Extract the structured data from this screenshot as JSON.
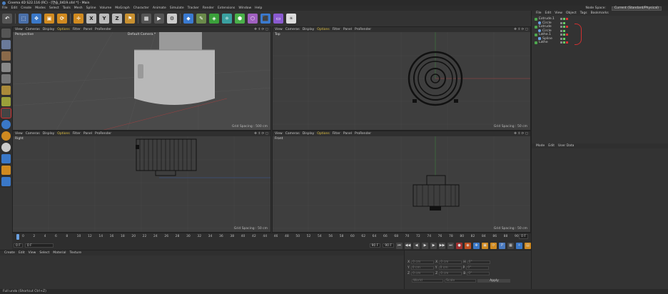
{
  "window": {
    "title": "Cinema 4D S22.116 (RC) - [연습_0419.c4d *] - Main"
  },
  "menubar": {
    "items": [
      "File",
      "Edit",
      "Create",
      "Modes",
      "Select",
      "Tools",
      "Mesh",
      "Spline",
      "Volume",
      "MoGraph",
      "Character",
      "Animate",
      "Simulate",
      "Tracker",
      "Render",
      "Extensions",
      "Window",
      "Help"
    ],
    "node_space_label": "Node Space:",
    "node_space_value": "Current (Standard/Physical)"
  },
  "toolbar": {
    "axis_labels": [
      "X",
      "Y",
      "Z"
    ]
  },
  "viewports": [
    {
      "id": "perspective",
      "menu": [
        "View",
        "Cameras",
        "Display",
        "Options",
        "Filter",
        "Panel",
        "ProRender"
      ],
      "label": "Perspective",
      "camera": "Default Camera.*",
      "grid": "Grid Spacing : 500 cm"
    },
    {
      "id": "top",
      "menu": [
        "View",
        "Cameras",
        "Display",
        "Options",
        "Filter",
        "Panel",
        "ProRender"
      ],
      "label": "Top",
      "grid": "Grid Spacing : 50 cm"
    },
    {
      "id": "right",
      "menu": [
        "View",
        "Cameras",
        "Display",
        "Options",
        "Filter",
        "Panel",
        "ProRender"
      ],
      "label": "Right",
      "grid": "Grid Spacing : 50 cm"
    },
    {
      "id": "front",
      "menu": [
        "View",
        "Cameras",
        "Display",
        "Options",
        "Filter",
        "Panel",
        "ProRender"
      ],
      "label": "Front",
      "grid": "Grid Spacing : 50 cm"
    }
  ],
  "object_manager": {
    "menu": [
      "File",
      "Edit",
      "View",
      "Object",
      "Tags",
      "Bookmarks"
    ],
    "objects": [
      {
        "name": "Extrude.1",
        "indent": 0,
        "color": "#4ea84e"
      },
      {
        "name": "Circle",
        "indent": 1,
        "color": "#6aa0e0"
      },
      {
        "name": "Extrude",
        "indent": 0,
        "color": "#4ea84e"
      },
      {
        "name": "Circle",
        "indent": 1,
        "color": "#6aa0e0"
      },
      {
        "name": "Lathe.1",
        "indent": 0,
        "color": "#4ea84e"
      },
      {
        "name": "Spline",
        "indent": 1,
        "color": "#6aa0e0"
      },
      {
        "name": "Lathe",
        "indent": 0,
        "color": "#4ea84e"
      }
    ]
  },
  "attribute_manager": {
    "menu": [
      "Mode",
      "Edit",
      "User Data"
    ]
  },
  "timeline": {
    "ticks": [
      "0",
      "2",
      "4",
      "6",
      "8",
      "10",
      "12",
      "14",
      "16",
      "18",
      "20",
      "22",
      "24",
      "26",
      "28",
      "30",
      "32",
      "34",
      "36",
      "38",
      "40",
      "42",
      "44",
      "46",
      "48",
      "50",
      "52",
      "54",
      "56",
      "58",
      "60",
      "62",
      "64",
      "66",
      "68",
      "70",
      "72",
      "74",
      "76",
      "78",
      "80",
      "82",
      "84",
      "86",
      "88",
      "90"
    ],
    "current_frame": "0 F",
    "start_frame": "0 F",
    "end_frame": "90 F",
    "end_frame2": "90 F",
    "frame_field": "0 F"
  },
  "material_manager": {
    "menu": [
      "Create",
      "Edit",
      "View",
      "Select",
      "Material",
      "Texture"
    ]
  },
  "coordinates": {
    "rows": [
      {
        "axis": "X",
        "pos": "0 cm",
        "axis2": "X",
        "size": "0 cm",
        "axis3": "H",
        "rot": "0°"
      },
      {
        "axis": "Y",
        "pos": "0 cm",
        "axis2": "Y",
        "size": "0 cm",
        "axis3": "P",
        "rot": "0°"
      },
      {
        "axis": "Z",
        "pos": "0 cm",
        "axis2": "Z",
        "size": "0 cm",
        "axis3": "B",
        "rot": "0°"
      }
    ],
    "mode1": "World",
    "mode2": "Scale",
    "apply_label": "Apply"
  },
  "statusbar": {
    "text": "Full undo (Shortcut Ctrl+Z)"
  }
}
